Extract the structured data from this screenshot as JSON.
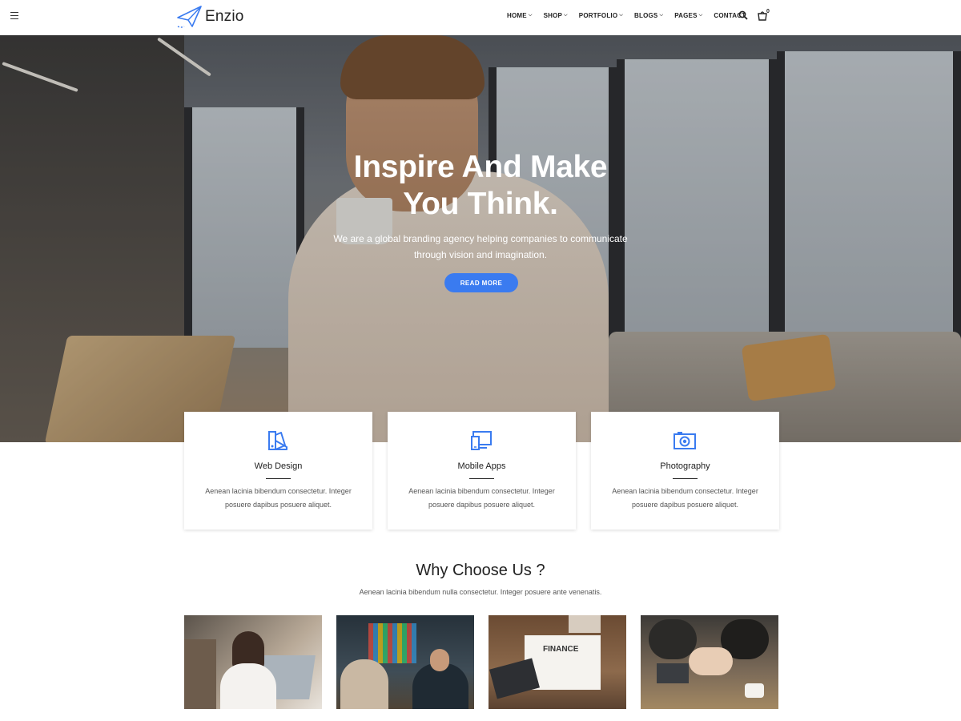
{
  "brand": {
    "name": "Enzio",
    "accent": "#3a7bf0"
  },
  "nav": {
    "items": [
      {
        "label": "HOME",
        "has_dropdown": true
      },
      {
        "label": "SHOP",
        "has_dropdown": true
      },
      {
        "label": "PORTFOLIO",
        "has_dropdown": true
      },
      {
        "label": "BLOGS",
        "has_dropdown": true
      },
      {
        "label": "PAGES",
        "has_dropdown": true
      },
      {
        "label": "CONTACT",
        "has_dropdown": false
      }
    ],
    "cart_count": "0",
    "icons": [
      "menu-icon",
      "search-icon",
      "cart-icon"
    ]
  },
  "hero": {
    "title_line1": "Inspire And Make",
    "title_line2": "You Think.",
    "subtitle_line1": "We are a global branding agency helping companies to communicate",
    "subtitle_line2": "through vision and imagination.",
    "button_label": "READ MORE"
  },
  "services": [
    {
      "icon": "palette-icon",
      "title": "Web Design",
      "text_line1": "Aenean lacinia bibendum consectetur. Integer",
      "text_line2": "posuere dapibus posuere aliquet."
    },
    {
      "icon": "devices-icon",
      "title": "Mobile Apps",
      "text_line1": "Aenean lacinia bibendum consectetur. Integer",
      "text_line2": "posuere dapibus posuere aliquet."
    },
    {
      "icon": "camera-icon",
      "title": "Photography",
      "text_line1": "Aenean lacinia bibendum consectetur. Integer",
      "text_line2": "posuere dapibus posuere aliquet."
    }
  ],
  "why": {
    "title": "Why Choose Us ?",
    "subtitle": "Aenean lacinia bibendum nulla consectetur. Integer posuere ante venenatis.",
    "finance_label": "FINANCE"
  }
}
